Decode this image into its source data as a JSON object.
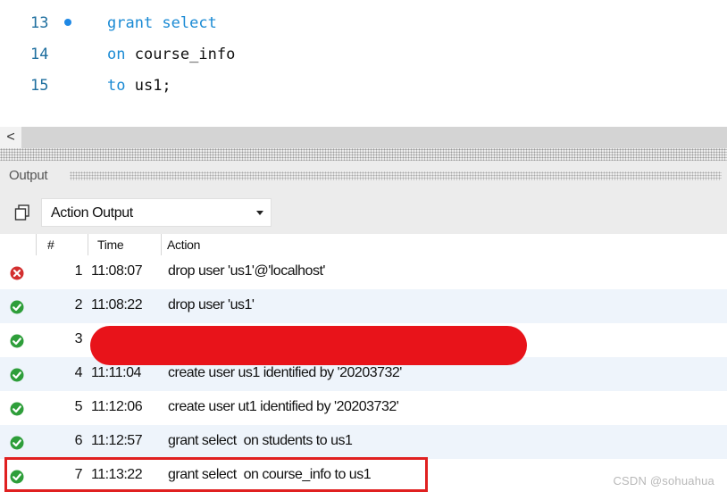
{
  "editor": {
    "lines": [
      {
        "number": "13",
        "breakpoint": true,
        "tokens": [
          {
            "text": "grant select",
            "kind": "keyword"
          }
        ]
      },
      {
        "number": "14",
        "breakpoint": false,
        "tokens": [
          {
            "text": "on",
            "kind": "keyword"
          },
          {
            "text": " course_info",
            "kind": "plain"
          }
        ]
      },
      {
        "number": "15",
        "breakpoint": false,
        "tokens": [
          {
            "text": "to",
            "kind": "keyword"
          },
          {
            "text": " us1;",
            "kind": "plain"
          }
        ]
      }
    ]
  },
  "scrollbar": {
    "left_arrow": "<"
  },
  "output": {
    "title": "Output",
    "view_select": "Action Output",
    "columns": {
      "icon": "",
      "num": "#",
      "time": "Time",
      "action": "Action"
    },
    "rows": [
      {
        "status": "error",
        "num": "1",
        "time": "11:08:07",
        "action": "drop user 'us1'@'localhost'"
      },
      {
        "status": "success",
        "num": "2",
        "time": "11:08:22",
        "action": "drop user 'us1'"
      },
      {
        "status": "success",
        "num": "3",
        "time": "",
        "action": ""
      },
      {
        "status": "success",
        "num": "4",
        "time": "11:11:04",
        "action": "create user us1 identified by '20203732'"
      },
      {
        "status": "success",
        "num": "5",
        "time": "11:12:06",
        "action": "create user ut1 identified by '20203732'"
      },
      {
        "status": "success",
        "num": "6",
        "time": "11:12:57",
        "action": "grant select  on students to us1"
      },
      {
        "status": "success",
        "num": "7",
        "time": "11:13:22",
        "action": "grant select  on course_info to us1"
      }
    ]
  },
  "colors": {
    "error": "#d32f2f",
    "success": "#2e9e3a",
    "keyword": "#1a8ad4",
    "alt_row": "#eef4fb",
    "highlight": "#e02020",
    "redaction": "#e8131a"
  },
  "watermark": "CSDN @sohuahua"
}
